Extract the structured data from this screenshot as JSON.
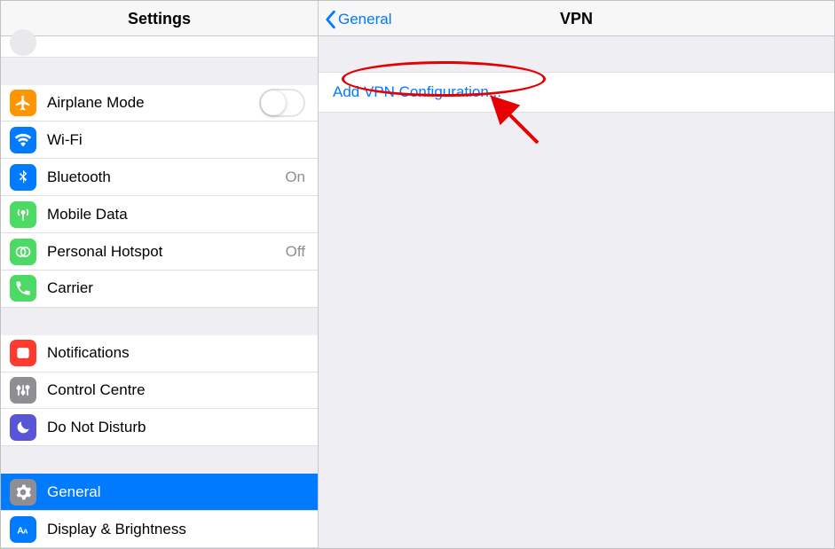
{
  "sidebar": {
    "title": "Settings",
    "groups": [
      [
        {
          "key": "airplane",
          "label": "Airplane Mode",
          "icon": "airplane",
          "type": "switch",
          "state": false
        },
        {
          "key": "wifi",
          "label": "Wi-Fi",
          "icon": "wifi",
          "type": "link",
          "value": ""
        },
        {
          "key": "bluetooth",
          "label": "Bluetooth",
          "icon": "bt",
          "type": "link",
          "value": "On"
        },
        {
          "key": "mobile",
          "label": "Mobile Data",
          "icon": "mobile",
          "type": "link",
          "value": ""
        },
        {
          "key": "hotspot",
          "label": "Personal Hotspot",
          "icon": "hotspot",
          "type": "link",
          "value": "Off"
        },
        {
          "key": "carrier",
          "label": "Carrier",
          "icon": "carrier",
          "type": "link",
          "value": ""
        }
      ],
      [
        {
          "key": "notifications",
          "label": "Notifications",
          "icon": "notif",
          "type": "link"
        },
        {
          "key": "control",
          "label": "Control Centre",
          "icon": "control",
          "type": "link"
        },
        {
          "key": "dnd",
          "label": "Do Not Disturb",
          "icon": "dnd",
          "type": "link"
        }
      ],
      [
        {
          "key": "general",
          "label": "General",
          "icon": "general",
          "type": "link",
          "selected": true
        },
        {
          "key": "display",
          "label": "Display & Brightness",
          "icon": "display",
          "type": "link"
        }
      ]
    ]
  },
  "detail": {
    "back_label": "General",
    "title": "VPN",
    "add_label": "Add VPN Configuration..."
  }
}
